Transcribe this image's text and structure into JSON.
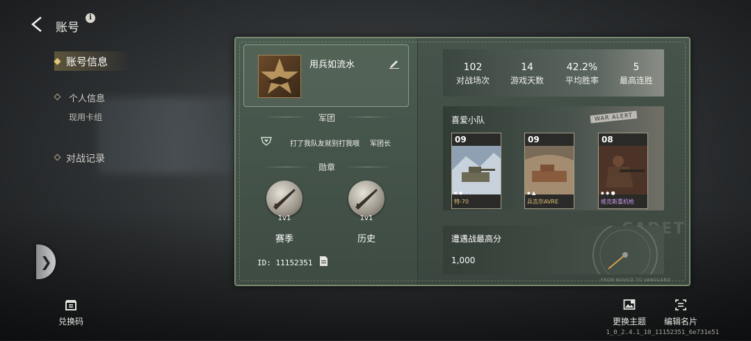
{
  "header": {
    "title": "账号",
    "info_glyph": "i"
  },
  "nav": {
    "items": [
      {
        "label": "账号信息",
        "active": true
      },
      {
        "label": "个人信息"
      },
      {
        "label": "现用卡组"
      },
      {
        "label": "对战记录"
      }
    ]
  },
  "bottom": {
    "redeem_label": "兑换码",
    "theme_label": "更换主题",
    "card_label": "编辑名片",
    "version": "1_0_2.4.1_10_11152351_6e731e51"
  },
  "profile": {
    "name": "用兵如流水",
    "legion_title": "军团",
    "legion_name": "打了我队友就别打我哦",
    "legion_role": "军团长",
    "medals_title": "勋章",
    "medals": [
      {
        "tag": "1v1",
        "label": "赛季"
      },
      {
        "tag": "1v1",
        "label": "历史"
      }
    ],
    "id_text": "ID: 11152351"
  },
  "stats": [
    {
      "value": "102",
      "label": "对战场次"
    },
    {
      "value": "14",
      "label": "游戏天数"
    },
    {
      "value": "42.2%",
      "label": "平均胜率"
    },
    {
      "value": "5",
      "label": "最高连胜"
    }
  ],
  "squad": {
    "title": "喜爱小队",
    "decor_tag": "WAR ALERT",
    "units": [
      {
        "level": "09",
        "name": "特-70"
      },
      {
        "level": "09",
        "name": "兵吉尔AVRE"
      },
      {
        "level": "08",
        "name": "维克斯重机枪"
      }
    ]
  },
  "encounter": {
    "title": "遭遇战最高分",
    "score": "1,000",
    "decor_word": "CADET",
    "decor_motto": "FROM NOVICE TO VANGUARD"
  },
  "colors": {
    "accent": "#e4c77a",
    "card_bg": "#3f4d44",
    "card_border": "#7a8a70"
  }
}
